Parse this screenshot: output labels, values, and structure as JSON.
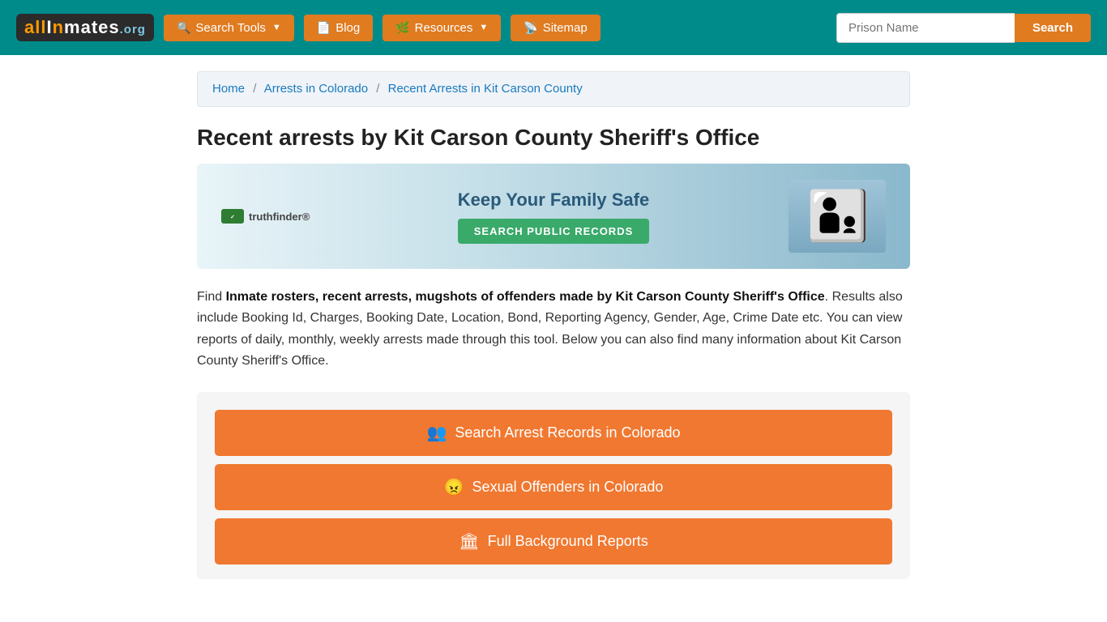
{
  "header": {
    "logo": "allinmates.org",
    "logo_all": "all",
    "logo_inmates": "Inmates",
    "logo_org": ".org",
    "nav": [
      {
        "id": "search-tools",
        "label": "Search Tools",
        "icon": "🔍",
        "has_dropdown": true
      },
      {
        "id": "blog",
        "label": "Blog",
        "icon": "📄",
        "has_dropdown": false
      },
      {
        "id": "resources",
        "label": "Resources",
        "icon": "🌿",
        "has_dropdown": true
      },
      {
        "id": "sitemap",
        "label": "Sitemap",
        "icon": "📡",
        "has_dropdown": false
      }
    ],
    "search_placeholder": "Prison Name",
    "search_button": "Search"
  },
  "breadcrumb": {
    "items": [
      {
        "label": "Home",
        "href": "#"
      },
      {
        "label": "Arrests in Colorado",
        "href": "#"
      },
      {
        "label": "Recent Arrests in Kit Carson County",
        "href": "#"
      }
    ]
  },
  "page": {
    "title": "Recent arrests by Kit Carson County Sheriff's Office",
    "ad": {
      "brand": "truthfinder®",
      "headline": "Keep Your Family Safe",
      "cta": "SEARCH PUBLIC RECORDS"
    },
    "description_normal": "Find ",
    "description_bold": "Inmate rosters, recent arrests, mugshots of offenders made by Kit Carson County Sheriff's Office",
    "description_rest": ". Results also include Booking Id, Charges, Booking Date, Location, Bond, Reporting Agency, Gender, Age, Crime Date etc. You can view reports of daily, monthly, weekly arrests made through this tool. Below you can also find many information about Kit Carson County Sheriff's Office.",
    "buttons": [
      {
        "id": "search-arrest",
        "label": "Search Arrest Records in Colorado",
        "icon": "👥"
      },
      {
        "id": "sexual-offenders",
        "label": "Sexual Offenders in Colorado",
        "icon": "😠"
      },
      {
        "id": "full-background",
        "label": "Full Background Reports",
        "icon": "🏛"
      }
    ]
  }
}
